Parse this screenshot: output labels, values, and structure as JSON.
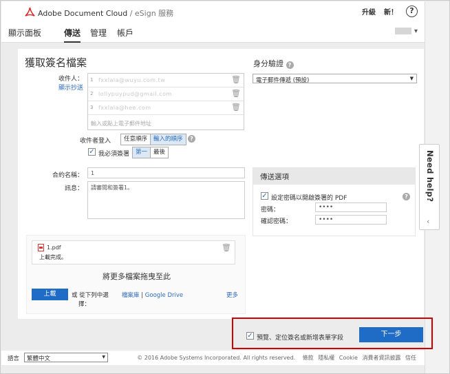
{
  "app": {
    "brand": "Adobe Document Cloud",
    "separator": " / ",
    "subtitle": "eSign 服務",
    "upgrade": "升級",
    "new_label": "新！",
    "help": "?"
  },
  "nav": {
    "tabs": [
      "顯示面板",
      "傳送",
      "管理",
      "帳戶"
    ],
    "active": "傳送",
    "user_caret": "▾"
  },
  "form": {
    "title": "獲取簽名檔案",
    "recipients_label": "收件人：",
    "show_cc": "顯示抄送",
    "recipients": [
      {
        "num": "1",
        "email": "fxxlala@wuyu.com.tw"
      },
      {
        "num": "2",
        "email": "lollypuypud@gmail.com"
      },
      {
        "num": "3",
        "email": "fxxlala@hee.com"
      }
    ],
    "recipient_placeholder": "輸入或點上電子郵件地址",
    "signing_order_label": "收件者登入",
    "order_any": "任意順序",
    "order_entered": "輸入的順序",
    "i_must_sign": "我必須簽署",
    "first": "第一",
    "last": "最後",
    "agreement_name_label": "合約名稱：",
    "agreement_name": "1",
    "message_label": "訊息：",
    "message": "請審閱和簽署1。",
    "auth_title": "身分驗證",
    "auth_selected": "電子郵件傳遞 (預設)",
    "options_title": "傳送選項",
    "password_protect": "設定密碼以開啟簽署的 PDF",
    "password_label": "密碼：",
    "password_value": "••••",
    "confirm_label": "確認密碼：",
    "confirm_value": "••••",
    "file_name": "1.pdf",
    "file_status": "上載完成。",
    "drag_text": "將更多檔案拖曳至此",
    "upload_button": "上載",
    "or_select_from": "或 從下列中選",
    "or_select_from_2": "擇：",
    "library": "檔案庫",
    "pipe": " | ",
    "google_drive": "Google Drive",
    "more": "更多",
    "preview_checkbox": "預覽、定位簽名或新增表單字段",
    "next_button": "下一步"
  },
  "footer": {
    "language_label": "語言",
    "language": "繁體中文",
    "copyright": "© 2016 Adobe Systems Incorporated. All rights reserved.",
    "links": [
      "條款",
      "隱私權",
      "Cookie",
      "消費者資訊披露",
      "信任"
    ]
  },
  "side": {
    "need_help": "Need help?",
    "chevron": "‹"
  },
  "colors": {
    "accent": "#1e6cc6",
    "highlight": "#d10000",
    "adobe_red": "#e02b2b"
  }
}
